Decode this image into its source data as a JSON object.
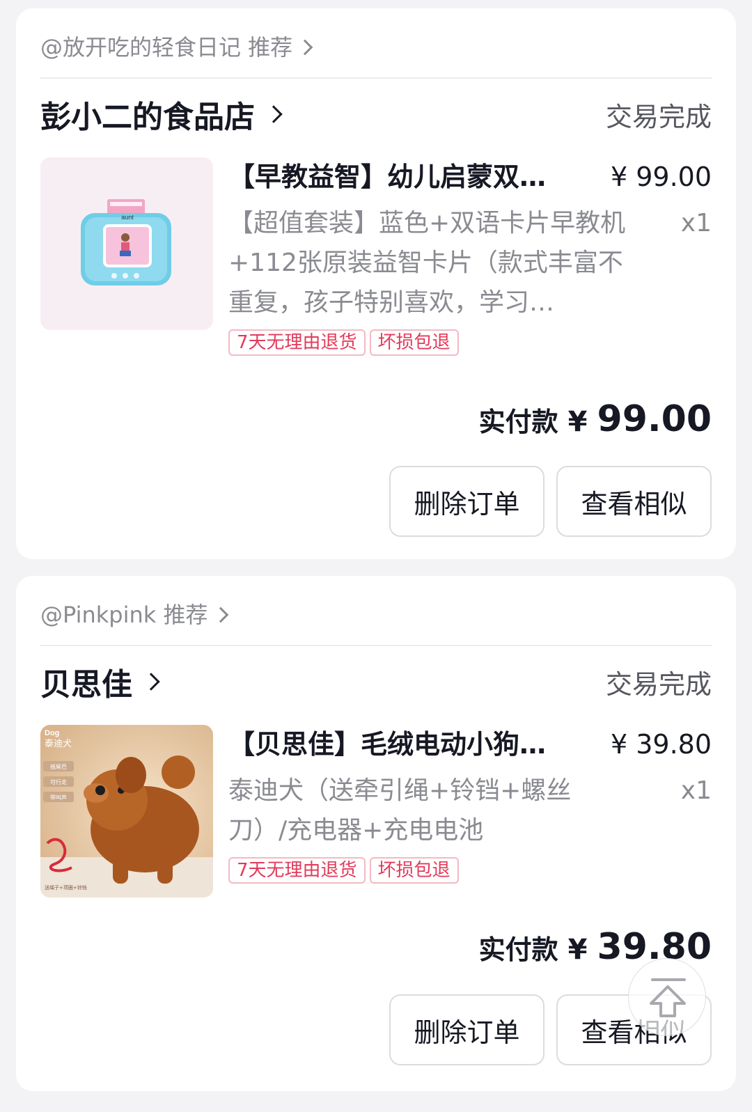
{
  "orders": [
    {
      "recommender": "@放开吃的轻食日记 推荐",
      "shop_name": "彭小二的食品店",
      "status": "交易完成",
      "product_title": "【早教益智】幼儿启蒙双…",
      "price": "¥ 99.00",
      "spec": "【超值套装】蓝色+双语卡片早教机+112张原装益智卡片（款式丰富不重复，孩子特别喜欢，学习…",
      "qty": "x1",
      "tags": [
        "7天无理由退货",
        "坏损包退"
      ],
      "total_label": "实付款",
      "total_currency": "¥",
      "total_amount": "99.00",
      "buttons": [
        "删除订单",
        "查看相似"
      ]
    },
    {
      "recommender": "@Pinkpink 推荐",
      "shop_name": "贝思佳",
      "status": "交易完成",
      "product_title": "【贝思佳】毛绒电动小狗…",
      "price": "¥ 39.80",
      "spec": "泰迪犬（送牵引绳+铃铛+螺丝刀）/充电器+充电电池",
      "qty": "x1",
      "tags": [
        "7天无理由退货",
        "坏损包退"
      ],
      "total_label": "实付款",
      "total_currency": "¥",
      "total_amount": "39.80",
      "buttons": [
        "删除订单",
        "查看相似"
      ]
    }
  ],
  "product_images": {
    "card1": {
      "card_word": "aunt"
    },
    "card2": {
      "label_en": "Dog",
      "label_cn": "泰迪犬",
      "badges": [
        "摇尾巴",
        "可行走",
        "带叫声"
      ],
      "footer": "送绳子+项圈+铃铛"
    }
  },
  "colors": {
    "tag_red": "#e23a5a",
    "text_primary": "#161823",
    "text_secondary": "#8a8b91"
  },
  "icons": {
    "scroll_top": "arrow-up-icon",
    "chevron": "chevron-right-icon"
  }
}
